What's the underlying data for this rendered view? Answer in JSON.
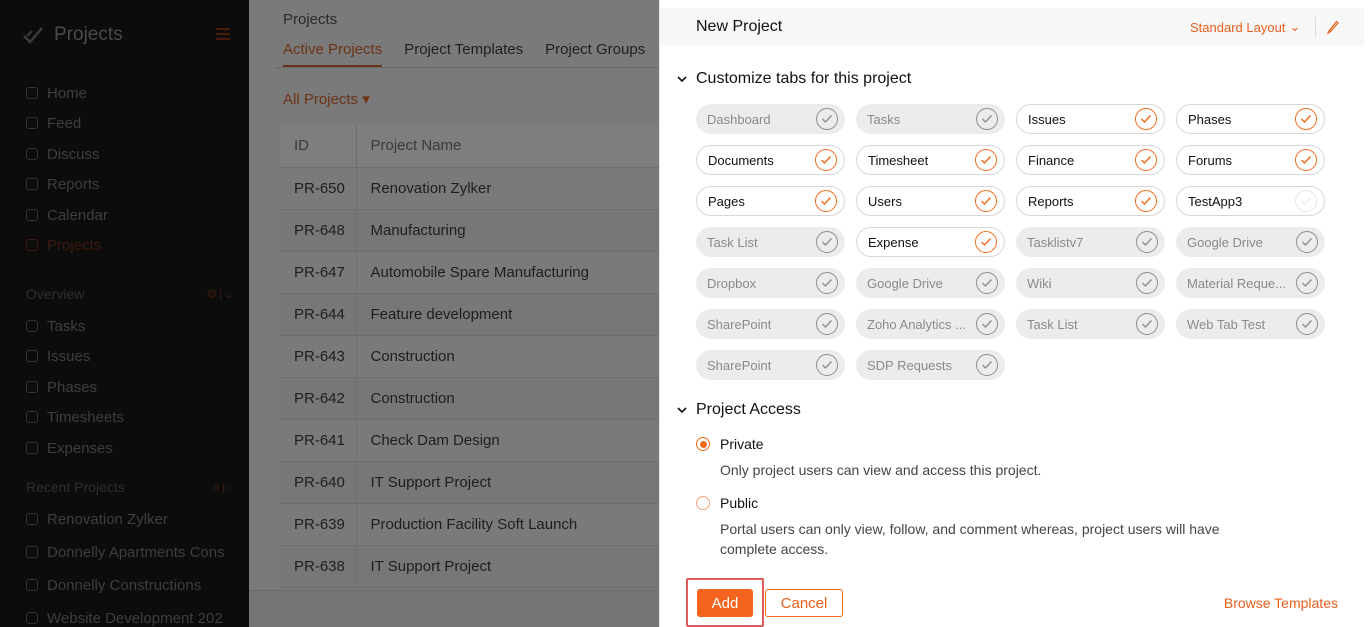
{
  "sidebar": {
    "brand": "Projects",
    "nav": [
      {
        "label": "Home",
        "icon": "home-icon"
      },
      {
        "label": "Feed",
        "icon": "feed-icon"
      },
      {
        "label": "Discuss",
        "icon": "discuss-icon"
      },
      {
        "label": "Reports",
        "icon": "reports-icon"
      },
      {
        "label": "Calendar",
        "icon": "calendar-icon"
      },
      {
        "label": "Projects",
        "icon": "projects-icon",
        "active": true
      }
    ],
    "overview_label": "Overview",
    "overview_items": [
      {
        "label": "Tasks",
        "icon": "tasks-icon"
      },
      {
        "label": "Issues",
        "icon": "issues-icon"
      },
      {
        "label": "Phases",
        "icon": "phases-icon"
      },
      {
        "label": "Timesheets",
        "icon": "timesheets-icon"
      },
      {
        "label": "Expenses",
        "icon": "expenses-icon"
      }
    ],
    "recent_label": "Recent Projects",
    "recent_items": [
      {
        "label": "Renovation Zylker"
      },
      {
        "label": "Donnelly Apartments Cons"
      },
      {
        "label": "Donnelly Constructions"
      },
      {
        "label": "Website Development 202"
      }
    ]
  },
  "main": {
    "title": "Projects",
    "tabs": [
      "Active Projects",
      "Project Templates",
      "Project Groups"
    ],
    "filter": "All Projects",
    "columns": [
      "ID",
      "Project Name"
    ],
    "rows": [
      {
        "id": "PR-650",
        "name": "Renovation Zylker"
      },
      {
        "id": "PR-648",
        "name": "Manufacturing"
      },
      {
        "id": "PR-647",
        "name": "Automobile Spare Manufacturing"
      },
      {
        "id": "PR-644",
        "name": "Feature development"
      },
      {
        "id": "PR-643",
        "name": "Construction"
      },
      {
        "id": "PR-642",
        "name": "Construction"
      },
      {
        "id": "PR-641",
        "name": "Check Dam Design"
      },
      {
        "id": "PR-640",
        "name": "IT Support Project"
      },
      {
        "id": "PR-639",
        "name": "Production Facility Soft Launch"
      },
      {
        "id": "PR-638",
        "name": "IT Support Project"
      }
    ]
  },
  "panel": {
    "title": "New Project",
    "layout_label": "Standard Layout",
    "tabs_section_title": "Customize tabs for this project",
    "tabs": [
      {
        "label": "Dashboard",
        "enabled": false
      },
      {
        "label": "Tasks",
        "enabled": false
      },
      {
        "label": "Issues",
        "enabled": true
      },
      {
        "label": "Phases",
        "enabled": true
      },
      {
        "label": "Documents",
        "enabled": true
      },
      {
        "label": "Timesheet",
        "enabled": true
      },
      {
        "label": "Finance",
        "enabled": true
      },
      {
        "label": "Forums",
        "enabled": true
      },
      {
        "label": "Pages",
        "enabled": true
      },
      {
        "label": "Users",
        "enabled": true
      },
      {
        "label": "Reports",
        "enabled": true
      },
      {
        "label": "TestApp3",
        "enabled": true,
        "unchecked": true
      },
      {
        "label": "Task List",
        "enabled": false
      },
      {
        "label": "Expense",
        "enabled": true
      },
      {
        "label": "Tasklistv7",
        "enabled": false
      },
      {
        "label": "Google Drive",
        "enabled": false
      },
      {
        "label": "Dropbox",
        "enabled": false
      },
      {
        "label": "Google Drive",
        "enabled": false
      },
      {
        "label": "Wiki",
        "enabled": false
      },
      {
        "label": "Material Reque...",
        "enabled": false
      },
      {
        "label": "SharePoint",
        "enabled": false
      },
      {
        "label": "Zoho Analytics ...",
        "enabled": false
      },
      {
        "label": "Task List",
        "enabled": false
      },
      {
        "label": "Web Tab Test",
        "enabled": false
      },
      {
        "label": "SharePoint",
        "enabled": false
      },
      {
        "label": "SDP Requests",
        "enabled": false
      }
    ],
    "access_section_title": "Project Access",
    "access": {
      "private_label": "Private",
      "private_desc": "Only project users can view and access this project.",
      "public_label": "Public",
      "public_desc": "Portal users can only view, follow, and comment whereas, project users will have complete access.",
      "selected": "Private"
    },
    "add_label": "Add",
    "cancel_label": "Cancel",
    "browse_label": "Browse Templates"
  },
  "colors": {
    "accent": "#f5641e",
    "sidebar_bg": "#0c0c0c",
    "overlay": "#7a7a7a"
  }
}
